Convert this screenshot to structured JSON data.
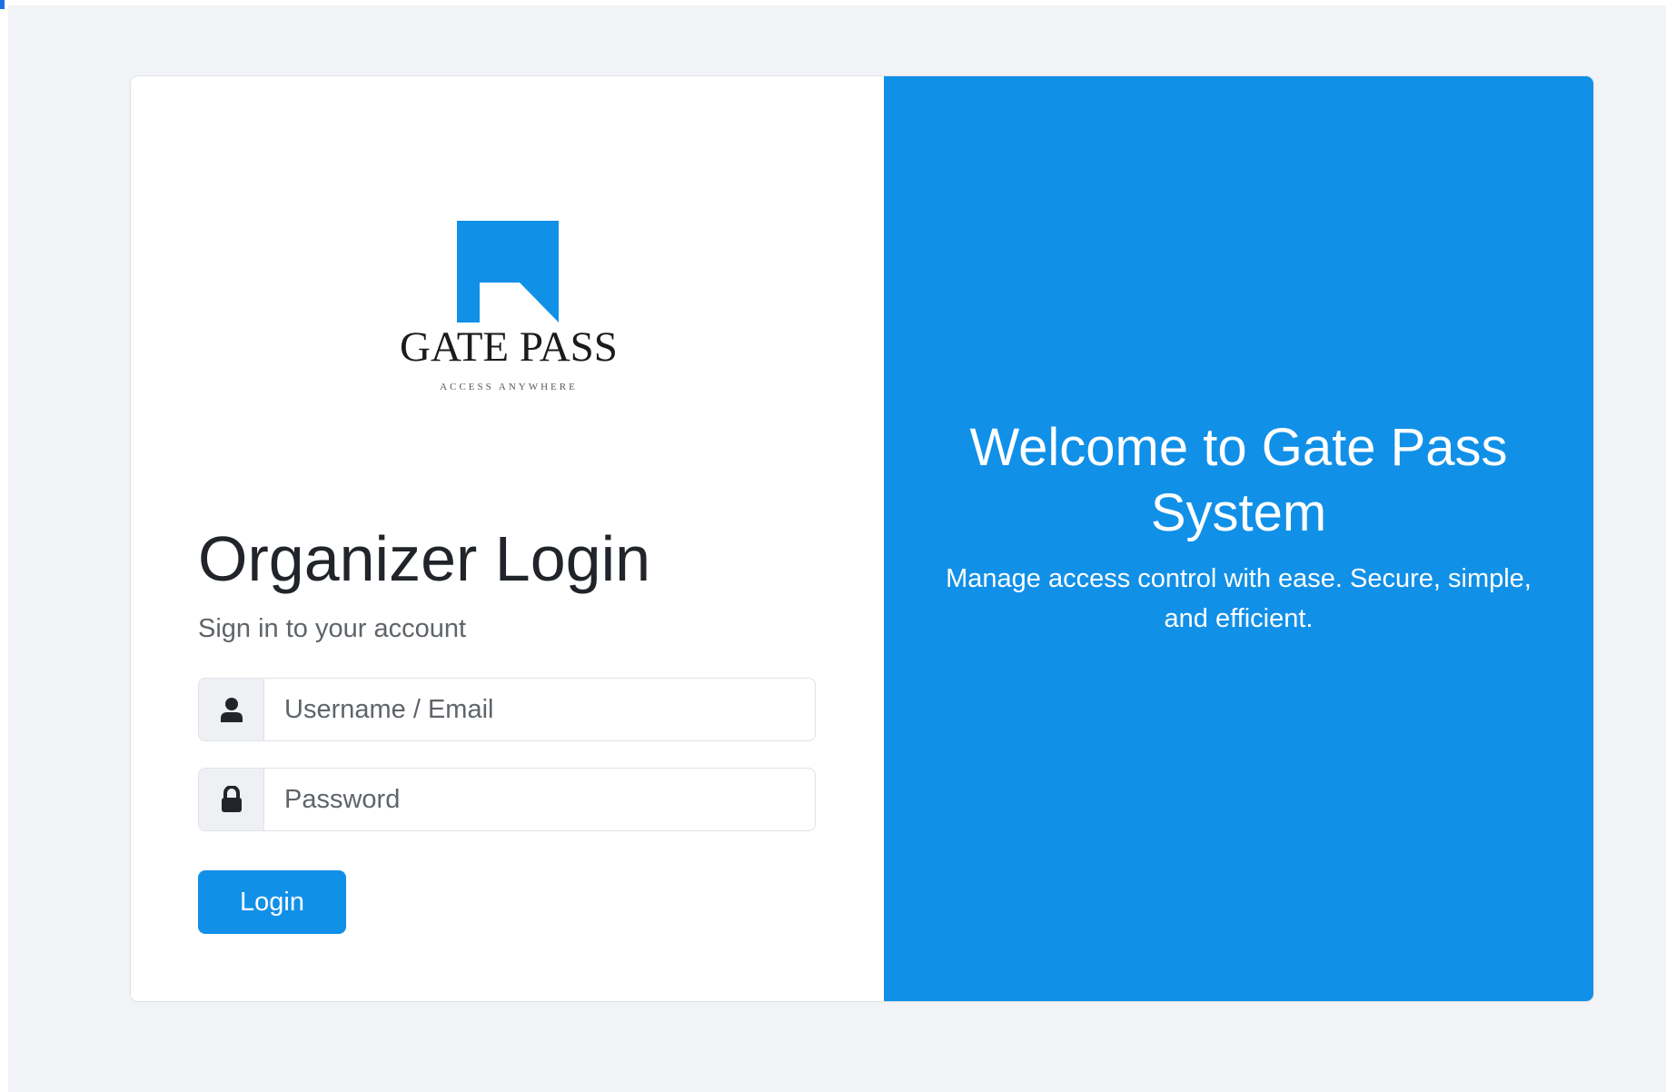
{
  "logo": {
    "name": "GATE PASS",
    "tagline": "ACCESS ANYWHERE",
    "color": "#1190e8"
  },
  "login": {
    "title": "Organizer Login",
    "subtitle": "Sign in to your account",
    "username": {
      "placeholder": "Username / Email",
      "value": "",
      "icon": "user-icon"
    },
    "password": {
      "placeholder": "Password",
      "value": "",
      "icon": "lock-icon"
    },
    "button_label": "Login"
  },
  "welcome": {
    "title": "Welcome to Gate Pass System",
    "text": "Manage access control with ease. Secure, simple, and efficient."
  },
  "colors": {
    "accent": "#1190e8",
    "page_background": "#f2f3f6",
    "text_dark": "#212529",
    "text_muted": "#5f6469"
  }
}
